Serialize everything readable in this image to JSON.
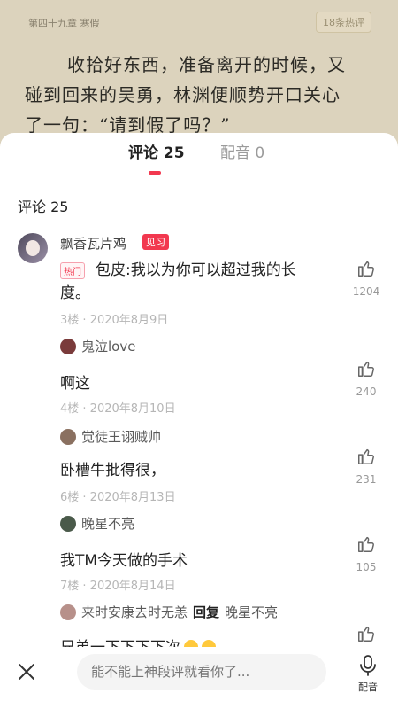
{
  "reader": {
    "chapter_title": "第四十九章 寒假",
    "paragraph_comments": "18条热评",
    "lines": [
      "收拾好东西，准备离开的时候，又",
      "碰到回来的吴勇，林渊便顺势开口关心",
      "了一句：“请到假了吗？”"
    ]
  },
  "tabs": {
    "comments": "评论 25",
    "dubbing": "配音 0"
  },
  "section_title": "评论 25",
  "top_comment": {
    "author": "飘香瓦片鸡",
    "level_badge": "见习",
    "hot_badge": "热门",
    "text_line1": "包皮:我以为你可以超过我的长",
    "text_line2": "度。",
    "meta": "3楼 · 2020年8月9日",
    "likes": "1204"
  },
  "replies": [
    {
      "user": "鬼泣love",
      "text": "啊这",
      "meta": "4楼 · 2020年8月10日",
      "likes": "240"
    },
    {
      "user": "觉徒王诩贼帅",
      "text": "卧槽牛批得很，",
      "meta": "6楼 · 2020年8月13日",
      "likes": "231"
    },
    {
      "user": "晚星不亮",
      "text": "我TM今天做的手术",
      "meta": "7楼 · 2020年8月14日",
      "likes": "105"
    },
    {
      "user": "来时安康去时无恙",
      "reply_label": "回复",
      "reply_to": "晚星不亮",
      "text": "兄弟一下下下下次",
      "likes": ""
    }
  ],
  "bottom": {
    "placeholder": "能不能上神段评就看你了...",
    "dub_label": "配音"
  },
  "colors": {
    "accent": "#f2384f"
  }
}
